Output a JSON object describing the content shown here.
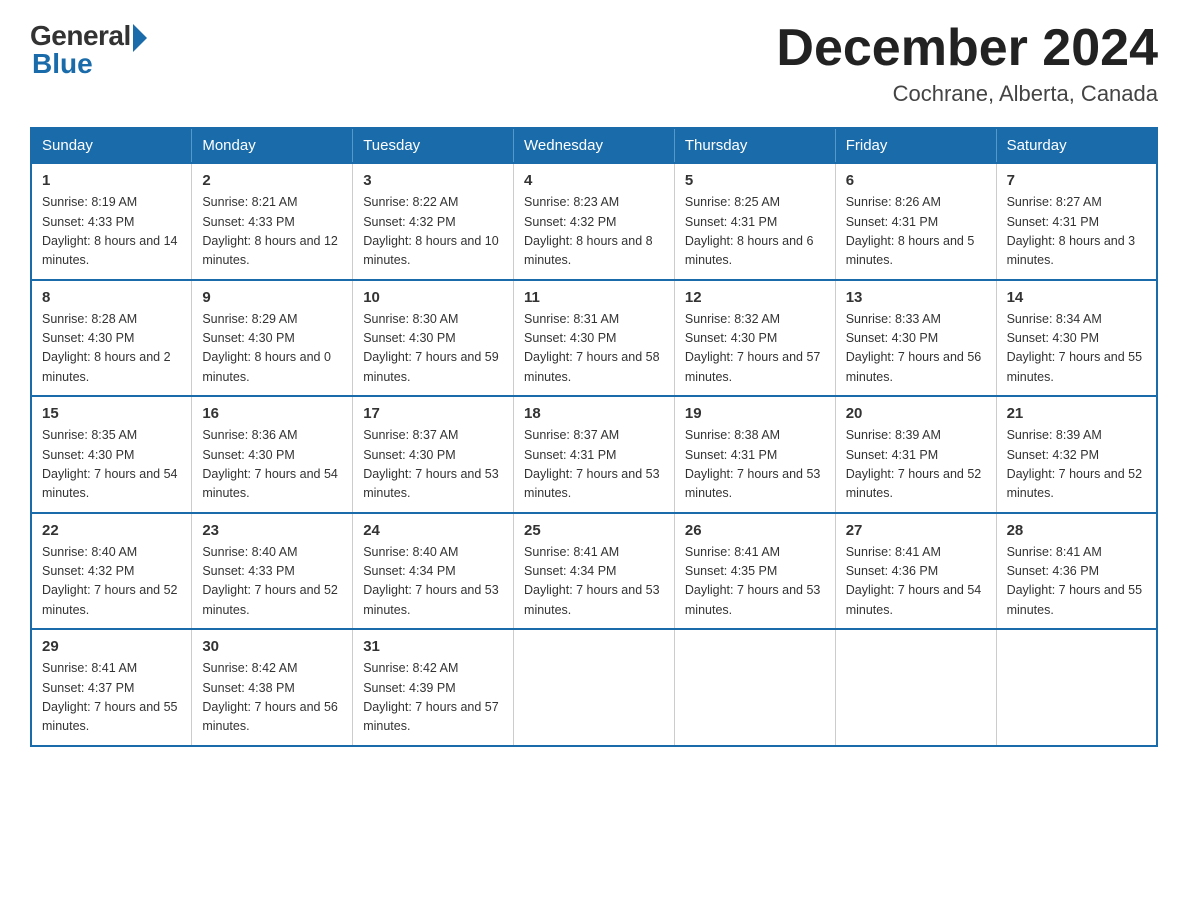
{
  "logo": {
    "general": "General",
    "blue": "Blue"
  },
  "title": "December 2024",
  "subtitle": "Cochrane, Alberta, Canada",
  "days_of_week": [
    "Sunday",
    "Monday",
    "Tuesday",
    "Wednesday",
    "Thursday",
    "Friday",
    "Saturday"
  ],
  "weeks": [
    [
      {
        "day": "1",
        "sunrise": "8:19 AM",
        "sunset": "4:33 PM",
        "daylight": "8 hours and 14 minutes."
      },
      {
        "day": "2",
        "sunrise": "8:21 AM",
        "sunset": "4:33 PM",
        "daylight": "8 hours and 12 minutes."
      },
      {
        "day": "3",
        "sunrise": "8:22 AM",
        "sunset": "4:32 PM",
        "daylight": "8 hours and 10 minutes."
      },
      {
        "day": "4",
        "sunrise": "8:23 AM",
        "sunset": "4:32 PM",
        "daylight": "8 hours and 8 minutes."
      },
      {
        "day": "5",
        "sunrise": "8:25 AM",
        "sunset": "4:31 PM",
        "daylight": "8 hours and 6 minutes."
      },
      {
        "day": "6",
        "sunrise": "8:26 AM",
        "sunset": "4:31 PM",
        "daylight": "8 hours and 5 minutes."
      },
      {
        "day": "7",
        "sunrise": "8:27 AM",
        "sunset": "4:31 PM",
        "daylight": "8 hours and 3 minutes."
      }
    ],
    [
      {
        "day": "8",
        "sunrise": "8:28 AM",
        "sunset": "4:30 PM",
        "daylight": "8 hours and 2 minutes."
      },
      {
        "day": "9",
        "sunrise": "8:29 AM",
        "sunset": "4:30 PM",
        "daylight": "8 hours and 0 minutes."
      },
      {
        "day": "10",
        "sunrise": "8:30 AM",
        "sunset": "4:30 PM",
        "daylight": "7 hours and 59 minutes."
      },
      {
        "day": "11",
        "sunrise": "8:31 AM",
        "sunset": "4:30 PM",
        "daylight": "7 hours and 58 minutes."
      },
      {
        "day": "12",
        "sunrise": "8:32 AM",
        "sunset": "4:30 PM",
        "daylight": "7 hours and 57 minutes."
      },
      {
        "day": "13",
        "sunrise": "8:33 AM",
        "sunset": "4:30 PM",
        "daylight": "7 hours and 56 minutes."
      },
      {
        "day": "14",
        "sunrise": "8:34 AM",
        "sunset": "4:30 PM",
        "daylight": "7 hours and 55 minutes."
      }
    ],
    [
      {
        "day": "15",
        "sunrise": "8:35 AM",
        "sunset": "4:30 PM",
        "daylight": "7 hours and 54 minutes."
      },
      {
        "day": "16",
        "sunrise": "8:36 AM",
        "sunset": "4:30 PM",
        "daylight": "7 hours and 54 minutes."
      },
      {
        "day": "17",
        "sunrise": "8:37 AM",
        "sunset": "4:30 PM",
        "daylight": "7 hours and 53 minutes."
      },
      {
        "day": "18",
        "sunrise": "8:37 AM",
        "sunset": "4:31 PM",
        "daylight": "7 hours and 53 minutes."
      },
      {
        "day": "19",
        "sunrise": "8:38 AM",
        "sunset": "4:31 PM",
        "daylight": "7 hours and 53 minutes."
      },
      {
        "day": "20",
        "sunrise": "8:39 AM",
        "sunset": "4:31 PM",
        "daylight": "7 hours and 52 minutes."
      },
      {
        "day": "21",
        "sunrise": "8:39 AM",
        "sunset": "4:32 PM",
        "daylight": "7 hours and 52 minutes."
      }
    ],
    [
      {
        "day": "22",
        "sunrise": "8:40 AM",
        "sunset": "4:32 PM",
        "daylight": "7 hours and 52 minutes."
      },
      {
        "day": "23",
        "sunrise": "8:40 AM",
        "sunset": "4:33 PM",
        "daylight": "7 hours and 52 minutes."
      },
      {
        "day": "24",
        "sunrise": "8:40 AM",
        "sunset": "4:34 PM",
        "daylight": "7 hours and 53 minutes."
      },
      {
        "day": "25",
        "sunrise": "8:41 AM",
        "sunset": "4:34 PM",
        "daylight": "7 hours and 53 minutes."
      },
      {
        "day": "26",
        "sunrise": "8:41 AM",
        "sunset": "4:35 PM",
        "daylight": "7 hours and 53 minutes."
      },
      {
        "day": "27",
        "sunrise": "8:41 AM",
        "sunset": "4:36 PM",
        "daylight": "7 hours and 54 minutes."
      },
      {
        "day": "28",
        "sunrise": "8:41 AM",
        "sunset": "4:36 PM",
        "daylight": "7 hours and 55 minutes."
      }
    ],
    [
      {
        "day": "29",
        "sunrise": "8:41 AM",
        "sunset": "4:37 PM",
        "daylight": "7 hours and 55 minutes."
      },
      {
        "day": "30",
        "sunrise": "8:42 AM",
        "sunset": "4:38 PM",
        "daylight": "7 hours and 56 minutes."
      },
      {
        "day": "31",
        "sunrise": "8:42 AM",
        "sunset": "4:39 PM",
        "daylight": "7 hours and 57 minutes."
      },
      null,
      null,
      null,
      null
    ]
  ],
  "labels": {
    "sunrise": "Sunrise:",
    "sunset": "Sunset:",
    "daylight": "Daylight:"
  }
}
